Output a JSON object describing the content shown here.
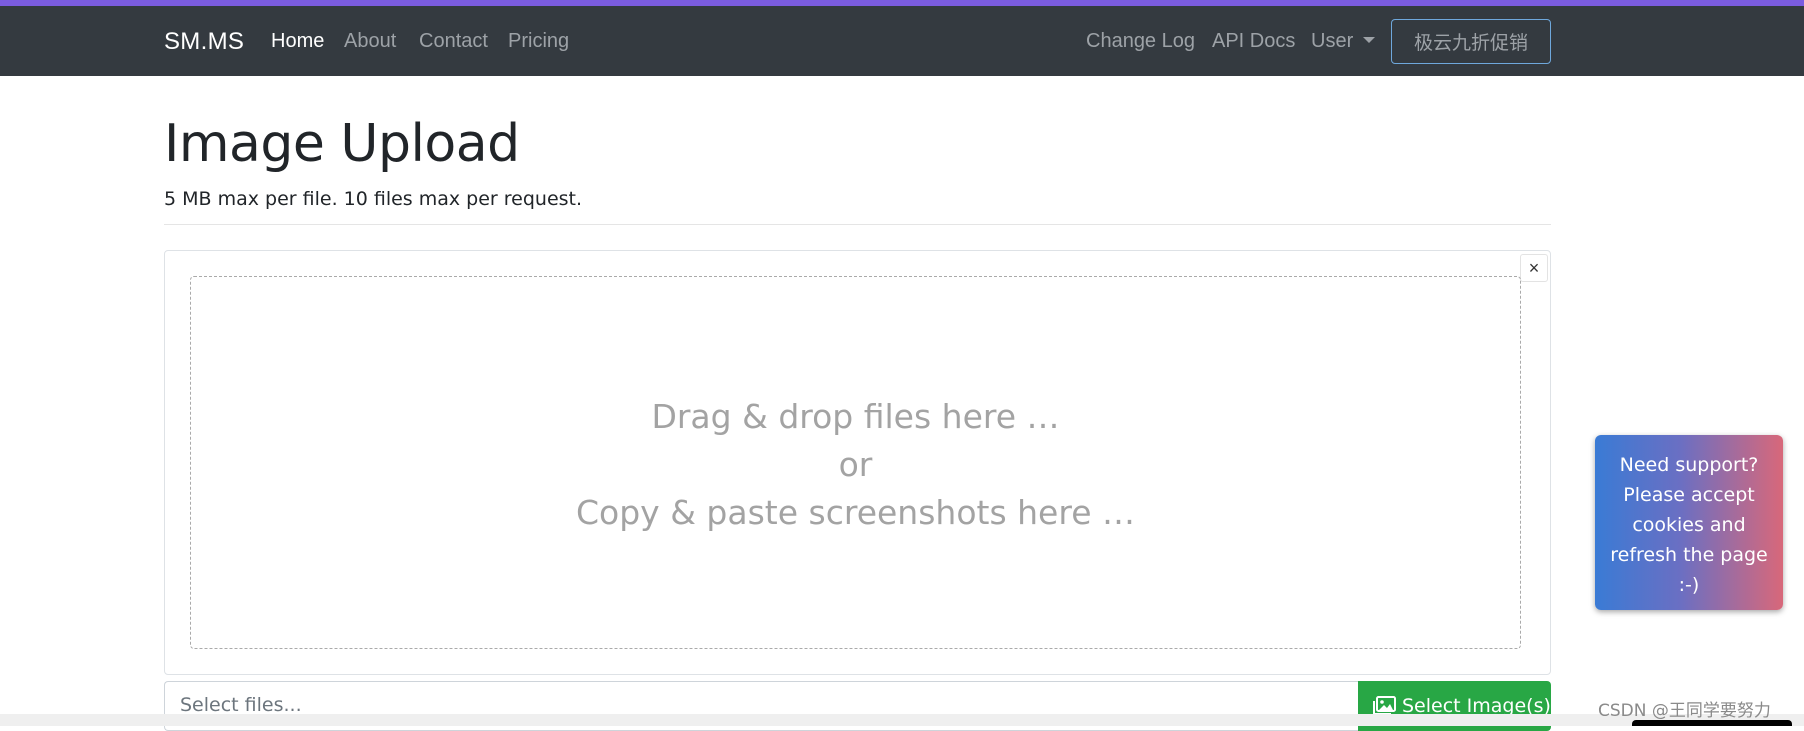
{
  "navbar": {
    "brand": "SM.MS",
    "left_links": [
      "Home",
      "About",
      "Contact",
      "Pricing"
    ],
    "right_links": [
      "Change Log",
      "API Docs"
    ],
    "user_dropdown": "User",
    "promo_button": "极云九折促销"
  },
  "main": {
    "title": "Image Upload",
    "subtitle": "5 MB max per file. 10 files max per request.",
    "dropzone_lines": [
      "Drag & drop files here …",
      "or",
      "Copy & paste screenshots here …"
    ],
    "file_input_placeholder": "Select files...",
    "select_button": "Select Image(s)",
    "close_symbol": "×"
  },
  "support": {
    "text_lines": [
      "Need support?",
      "Please accept",
      "cookies and",
      "refresh the page",
      ":-)"
    ]
  },
  "watermark": "CSDN @王同学要努力",
  "colors": {
    "accent_bar": "#7b5ce0",
    "navbar_bg": "#343a40",
    "select_button_bg": "#28a745",
    "promo_border": "#6fa8dc"
  }
}
